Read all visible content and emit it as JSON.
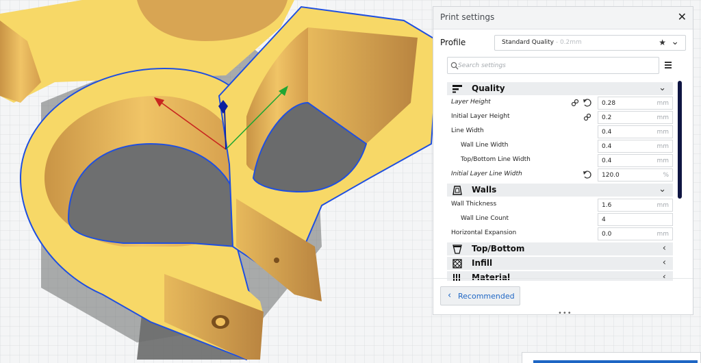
{
  "viewport": {
    "model_colors": {
      "top_face": "#f7d867",
      "side_face": "#e6b65a",
      "outline": "#1f4fe0",
      "shadow": "#6a6b6c"
    },
    "axes": {
      "x": "#c8261f",
      "y": "#20a633",
      "z": "#0c1fa0"
    }
  },
  "panel": {
    "title": "Print settings",
    "close_icon": "close-icon",
    "profile": {
      "label": "Profile",
      "name": "Standard Quality",
      "sub": " - 0.2mm"
    },
    "search": {
      "placeholder": "Search settings"
    },
    "categories": [
      {
        "label": "Quality",
        "icon": "quality-icon",
        "expanded": true
      },
      {
        "label": "Walls",
        "icon": "walls-icon",
        "expanded": true
      },
      {
        "label": "Top/Bottom",
        "icon": "top-bottom-icon",
        "expanded": false
      },
      {
        "label": "Infill",
        "icon": "infill-icon",
        "expanded": false
      },
      {
        "label": "Material",
        "icon": "material-icon",
        "expanded": false
      }
    ],
    "quality_rows": [
      {
        "label": "Layer Height",
        "value": "0.28",
        "unit": "mm"
      },
      {
        "label": "Initial Layer Height",
        "value": "0.2",
        "unit": "mm"
      },
      {
        "label": "Line Width",
        "value": "0.4",
        "unit": "mm"
      },
      {
        "label": "Wall Line Width",
        "value": "0.4",
        "unit": "mm"
      },
      {
        "label": "Top/Bottom Line Width",
        "value": "0.4",
        "unit": "mm"
      },
      {
        "label": "Initial Layer Line Width",
        "value": "120.0",
        "unit": "%"
      }
    ],
    "walls_rows": [
      {
        "label": "Wall Thickness",
        "value": "1.6",
        "unit": "mm"
      },
      {
        "label": "Wall Line Count",
        "value": "4",
        "unit": ""
      },
      {
        "label": "Horizontal Expansion",
        "value": "0.0",
        "unit": "mm"
      }
    ],
    "recommended_label": "Recommended",
    "accent": "#1e66c4"
  }
}
